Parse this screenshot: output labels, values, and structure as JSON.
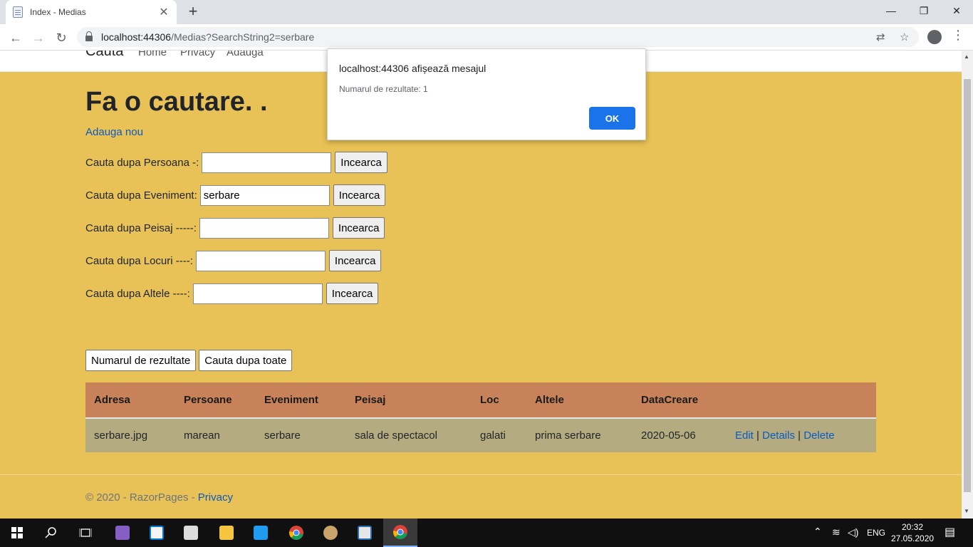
{
  "browser": {
    "tab_title": "Index - Medias",
    "url_host": "localhost:44306",
    "url_path": "/Medias?SearchString2=serbare"
  },
  "site": {
    "brand": "Cauta",
    "nav": [
      "Home",
      "Privacy",
      "Adauga"
    ]
  },
  "page": {
    "title": "Fa o cautare. .",
    "add_link": "Adauga nou",
    "search_rows": [
      {
        "label": "Cauta dupa Persoana -:",
        "value": "",
        "button": "Incearca"
      },
      {
        "label": "Cauta dupa Eveniment:",
        "value": "serbare",
        "button": "Incearca"
      },
      {
        "label": "Cauta dupa Peisaj -----:",
        "value": "",
        "button": "Incearca"
      },
      {
        "label": "Cauta dupa Locuri ----:",
        "value": "",
        "button": "Incearca"
      },
      {
        "label": "Cauta dupa Altele ----:",
        "value": "",
        "button": "Incearca"
      }
    ],
    "count_button": "Numarul de rezultate",
    "all_button": "Cauta dupa toate"
  },
  "table": {
    "headers": [
      "Adresa",
      "Persoane",
      "Eveniment",
      "Peisaj",
      "Loc",
      "Altele",
      "DataCreare"
    ],
    "rows": [
      {
        "cells": [
          "serbare.jpg",
          "marean",
          "serbare",
          "sala de spectacol",
          "galati",
          "prima serbare",
          "2020-05-06"
        ],
        "actions": [
          "Edit",
          "Details",
          "Delete"
        ],
        "separator": "|"
      }
    ]
  },
  "footer": {
    "text": "© 2020 - RazorPages - ",
    "link": "Privacy"
  },
  "dialog": {
    "title": "localhost:44306 afișează mesajul",
    "message": "Numarul de rezultate: 1",
    "ok": "OK"
  },
  "taskbar": {
    "language": "ENG",
    "time": "20:32",
    "date": "27.05.2020"
  },
  "colors": {
    "page_bg": "#e8c256",
    "table_header": "#c8825a",
    "table_row": "#b4ac80",
    "link": "#0a5ac2",
    "dialog_button": "#1a73e8"
  }
}
